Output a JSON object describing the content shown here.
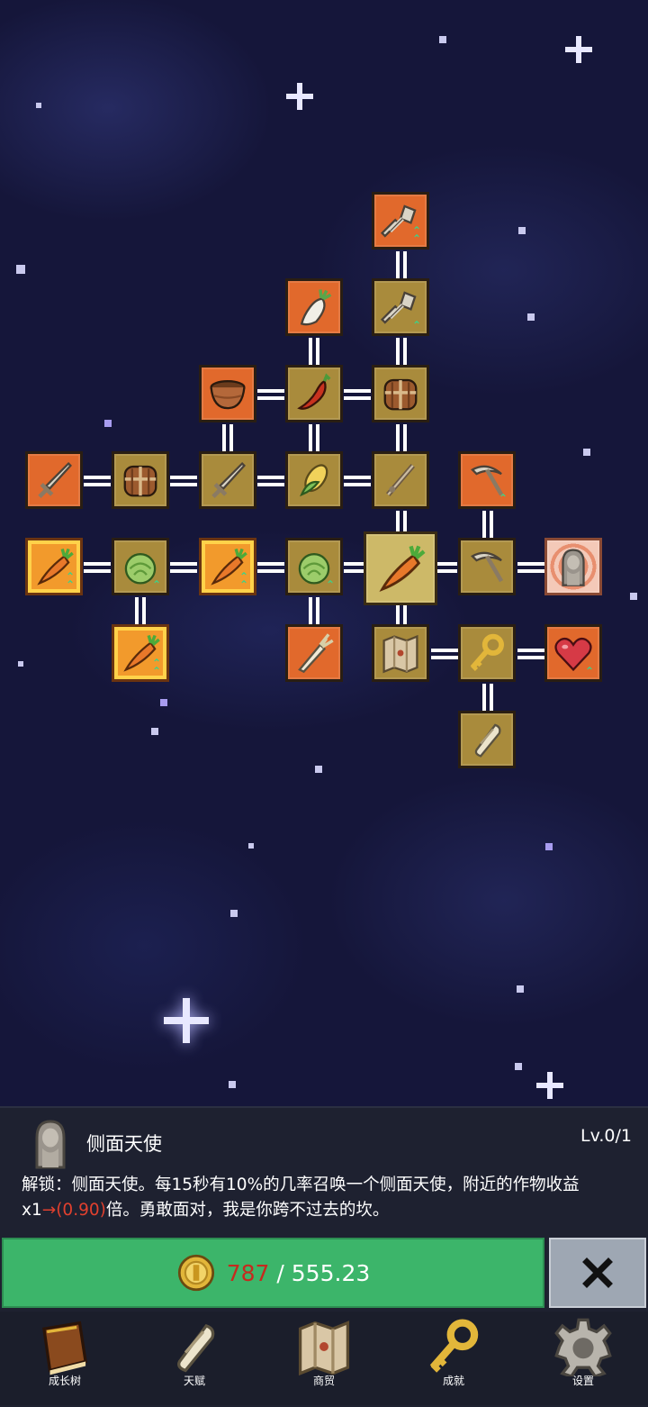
{
  "skill_panel": {
    "name": "侧面天使",
    "level": "Lv.0/1",
    "desc_main": "解锁：侧面天使。每15秒有10%的几率召唤一个侧面天使，附近的作物收益x1",
    "desc_arrow": "→(0.90)",
    "desc_tail": "倍。勇敢面对，我是你跨不过去的坎。"
  },
  "purchase": {
    "have": "787",
    "separator": " / ",
    "cost": "555.23"
  },
  "nav": {
    "growth_tree": "成长树",
    "talent": "天赋",
    "trade": "商贸",
    "achievement": "成就",
    "settings": "设置"
  },
  "tree_nodes": [
    {
      "icon": "shovel-icon",
      "style": "orange"
    },
    {
      "icon": "radish-icon",
      "style": "orange"
    },
    {
      "icon": "shovel-icon",
      "style": "gold"
    },
    {
      "icon": "bowl-icon",
      "style": "orange"
    },
    {
      "icon": "chili-icon",
      "style": "gold"
    },
    {
      "icon": "chest-icon",
      "style": "gold"
    },
    {
      "icon": "sword-icon",
      "style": "orange"
    },
    {
      "icon": "chest-icon",
      "style": "gold"
    },
    {
      "icon": "sword-icon",
      "style": "gold"
    },
    {
      "icon": "corn-icon",
      "style": "gold"
    },
    {
      "icon": "staff-icon",
      "style": "gold"
    },
    {
      "icon": "pickaxe-icon",
      "style": "orange"
    },
    {
      "icon": "carrot-icon",
      "style": "bright"
    },
    {
      "icon": "cabbage-icon",
      "style": "gold"
    },
    {
      "icon": "carrot-icon",
      "style": "bright"
    },
    {
      "icon": "cabbage-icon",
      "style": "gold"
    },
    {
      "icon": "carrot-icon",
      "style": "selected"
    },
    {
      "icon": "pickaxe-icon",
      "style": "gold"
    },
    {
      "icon": "angel-statue-icon",
      "style": "statue"
    },
    {
      "icon": "carrot-icon",
      "style": "bright"
    },
    {
      "icon": "leek-icon",
      "style": "orange"
    },
    {
      "icon": "map-icon",
      "style": "gold"
    },
    {
      "icon": "key-icon",
      "style": "gold"
    },
    {
      "icon": "heart-icon",
      "style": "orange"
    },
    {
      "icon": "scroll-icon",
      "style": "gold"
    }
  ],
  "colors": {
    "space": "#15163a",
    "node_orange": "#e1692c",
    "node_gold": "#a98b3c",
    "buy_button": "#3cb56a",
    "close_button": "#9ea7b3",
    "price_have": "#c62a1e"
  }
}
